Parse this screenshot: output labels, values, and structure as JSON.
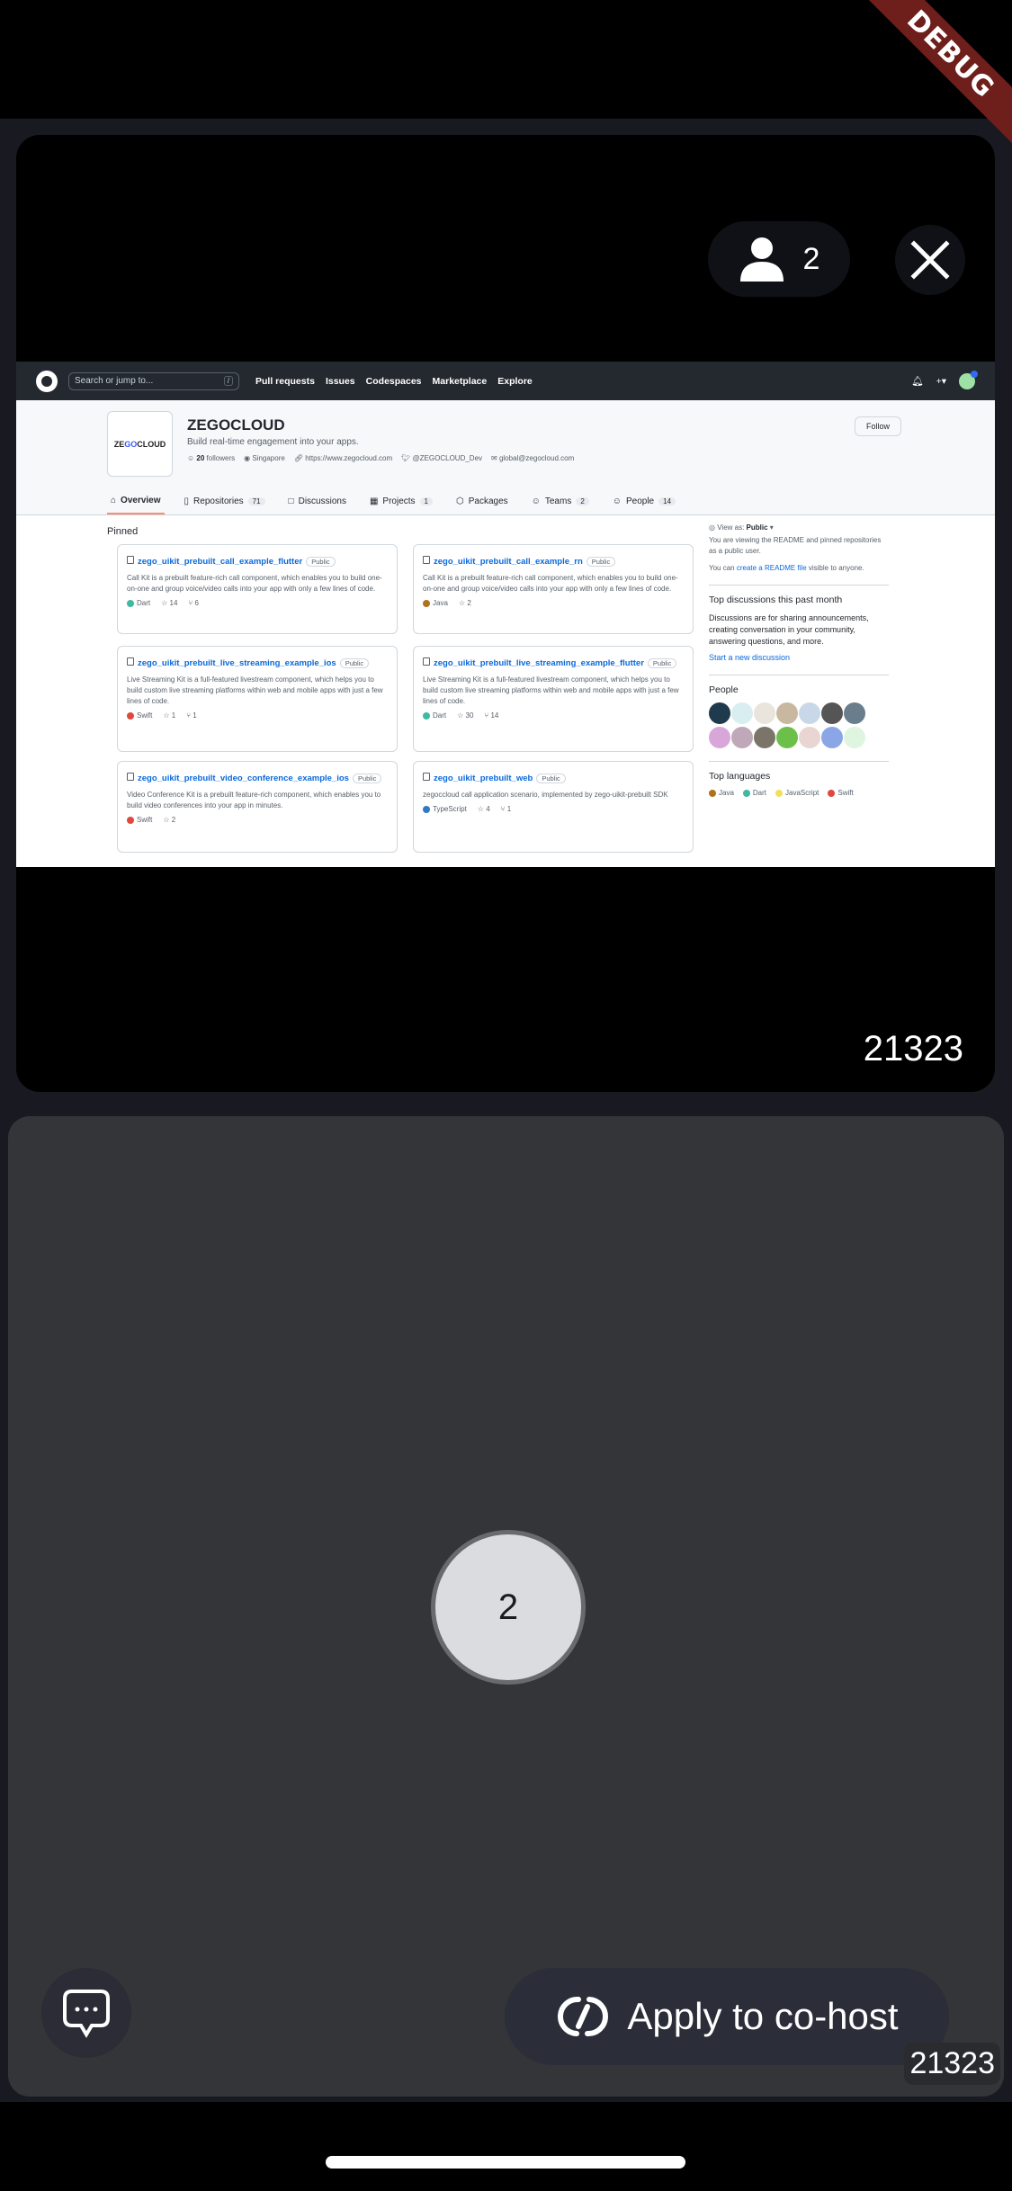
{
  "debug_banner": {
    "label": "DEBUG"
  },
  "live": {
    "audience_count": "2",
    "host_user_id": "21323"
  },
  "screen_share": {
    "header": {
      "search_placeholder": "Search or jump to...",
      "search_shortcut": "/",
      "nav": [
        "Pull requests",
        "Issues",
        "Codespaces",
        "Marketplace",
        "Explore"
      ]
    },
    "org": {
      "logo_text_a": "ZE",
      "logo_text_b": "GO",
      "logo_text_c": "CLOUD",
      "name": "ZEGOCLOUD",
      "description": "Build real-time engagement into your apps.",
      "followers_count": "20",
      "followers_label": "followers",
      "location": "Singapore",
      "website": "https://www.zegocloud.com",
      "twitter": "@ZEGOCLOUD_Dev",
      "email": "global@zegocloud.com",
      "follow_label": "Follow"
    },
    "tabs": [
      {
        "label": "Overview",
        "count": null
      },
      {
        "label": "Repositories",
        "count": "71"
      },
      {
        "label": "Discussions",
        "count": null
      },
      {
        "label": "Projects",
        "count": "1"
      },
      {
        "label": "Packages",
        "count": null
      },
      {
        "label": "Teams",
        "count": "2"
      },
      {
        "label": "People",
        "count": "14"
      }
    ],
    "pinned_title": "Pinned",
    "pinned": [
      {
        "name": "zego_uikit_prebuilt_call_example_flutter",
        "visibility": "Public",
        "description": "Call Kit is a prebuilt feature-rich call component, which enables you to build one-on-one and group voice/video calls into your app with only a few lines of code.",
        "language": "Dart",
        "lang_color": "#3fb9a0",
        "stars": "14",
        "forks": "6"
      },
      {
        "name": "zego_uikit_prebuilt_call_example_rn",
        "visibility": "Public",
        "description": "Call Kit is a prebuilt feature-rich call component, which enables you to build one-on-one and group voice/video calls into your app with only a few lines of code.",
        "language": "Java",
        "lang_color": "#b07219",
        "stars": "2",
        "forks": null
      },
      {
        "name": "zego_uikit_prebuilt_live_streaming_example_ios",
        "visibility": "Public",
        "description": "Live Streaming Kit is a full-featured livestream component, which helps you to build custom live streaming platforms within web and mobile apps with just a few lines of code.",
        "language": "Swift",
        "lang_color": "#e0483e",
        "stars": "1",
        "forks": "1"
      },
      {
        "name": "zego_uikit_prebuilt_live_streaming_example_flutter",
        "visibility": "Public",
        "description": "Live Streaming Kit is a full-featured livestream component, which helps you to build custom live streaming platforms within web and mobile apps with just a few lines of code.",
        "language": "Dart",
        "lang_color": "#3fb9a0",
        "stars": "30",
        "forks": "14"
      },
      {
        "name": "zego_uikit_prebuilt_video_conference_example_ios",
        "visibility": "Public",
        "description": "Video Conference Kit is a prebuilt feature-rich component, which enables you to build video conferences into your app in minutes.",
        "language": "Swift",
        "lang_color": "#e0483e",
        "stars": "2",
        "forks": null
      },
      {
        "name": "zego_uikit_prebuilt_web",
        "visibility": "Public",
        "description": "zegoccloud call application scenario, implemented by zego-uikit-prebuilt SDK",
        "language": "TypeScript",
        "lang_color": "#3178c6",
        "stars": "4",
        "forks": "1"
      }
    ],
    "sidebar": {
      "view_as_label": "View as:",
      "view_as_value": "Public",
      "viewing_note": "You are viewing the README and pinned repositories as a public user.",
      "readme_prefix": "You can ",
      "readme_link": "create a README file",
      "readme_suffix": " visible to anyone.",
      "discussions_title": "Top discussions this past month",
      "discussions_text": "Discussions are for sharing announcements, creating conversation in your community, answering questions, and more.",
      "discussions_link": "Start a new discussion",
      "people_title": "People",
      "people_colors": [
        "#1f3a4d",
        "#d9eef0",
        "#e9e4dc",
        "#c9b8a0",
        "#c8d8e8",
        "#555",
        "#6a7d8c",
        "#d9a6d9",
        "#bfa9b8",
        "#7a7568",
        "#6cc04a",
        "#e9d6d2",
        "#8aa6e6",
        "#dff5df"
      ],
      "languages_title": "Top languages",
      "languages": [
        {
          "name": "Java",
          "color": "#b07219"
        },
        {
          "name": "Dart",
          "color": "#3fb9a0"
        },
        {
          "name": "JavaScript",
          "color": "#f1e05a"
        },
        {
          "name": "Swift",
          "color": "#e0483e"
        }
      ]
    }
  },
  "audience": {
    "avatar_initial": "2",
    "user_id": "21323"
  },
  "bottom_bar": {
    "cohost_label": "Apply to co-host"
  }
}
